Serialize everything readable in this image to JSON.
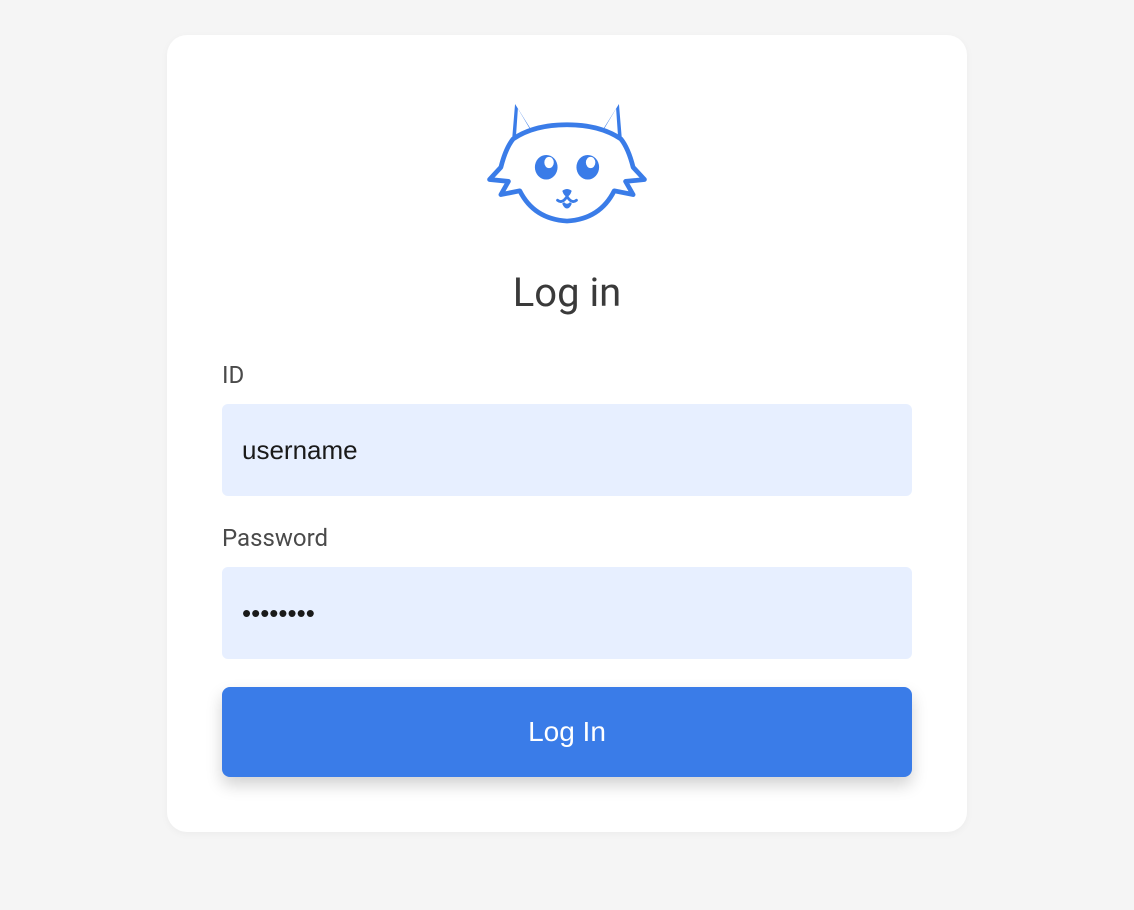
{
  "colors": {
    "accent": "#3a7ce8",
    "input_bg": "#e7efff"
  },
  "logo": {
    "name": "cat-logo-icon"
  },
  "heading": "Log in",
  "form": {
    "id_label": "ID",
    "id_placeholder": "username",
    "id_value": "",
    "password_label": "Password",
    "password_value": "password",
    "submit_label": "Log In"
  }
}
